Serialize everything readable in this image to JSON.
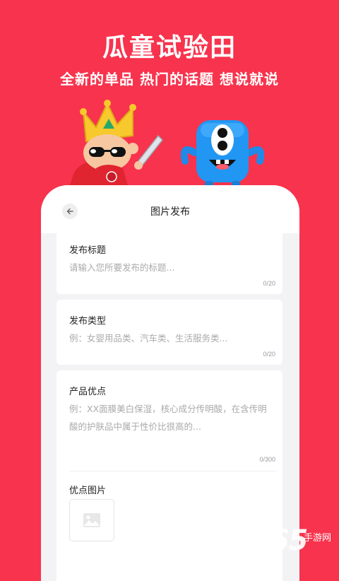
{
  "hero": {
    "title": "瓜童试验田",
    "subtitle": "全新的单品  热门的话题  想说就说"
  },
  "header": {
    "title": "图片发布",
    "back_icon": "arrow-left-icon"
  },
  "form": {
    "title_field": {
      "label": "发布标题",
      "placeholder": "请输入您所要发布的标题...",
      "counter": "0/20"
    },
    "type_field": {
      "label": "发布类型",
      "placeholder": "例：女婴用品类、汽车类、生活服务类...",
      "counter": "0/20"
    },
    "advantage_field": {
      "label": "产品优点",
      "placeholder_line1": "例：XX面膜美白保湿，核心成分传明酸，在含传明",
      "placeholder_line2": "酸的护肤品中属于性价比很高的...",
      "counter": "0/300"
    },
    "image_field": {
      "label": "优点图片",
      "upload_icon": "image-placeholder-icon"
    }
  },
  "watermark": {
    "number": "2265",
    "text": "手游网"
  },
  "colors": {
    "brand": "#f8334d",
    "panel": "#f3f3f5"
  }
}
